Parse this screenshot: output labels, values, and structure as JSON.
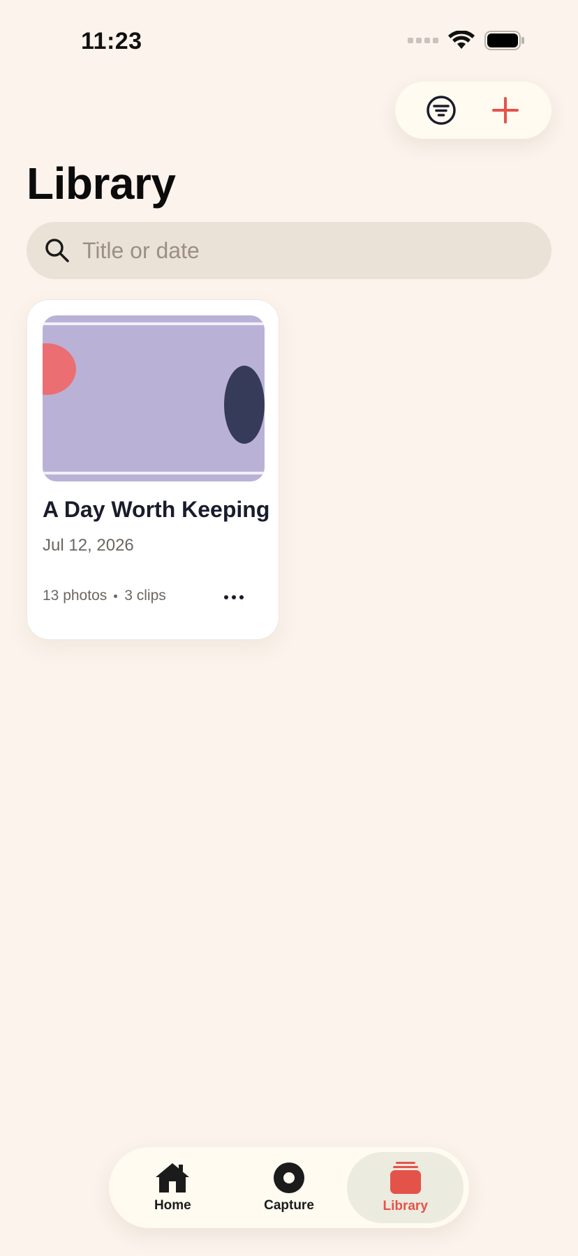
{
  "status_bar": {
    "time": "11:23"
  },
  "page": {
    "title": "Library"
  },
  "search": {
    "placeholder": "Title or date",
    "value": ""
  },
  "cards": [
    {
      "title": "A Day Worth Keeping",
      "date": "Jul 12, 2026",
      "photos": "13 photos",
      "clips": "3 clips"
    }
  ],
  "tabs": [
    {
      "label": "Home",
      "icon": "house-icon",
      "active": false
    },
    {
      "label": "Capture",
      "icon": "record-icon",
      "active": false
    },
    {
      "label": "Library",
      "icon": "stack-icon",
      "active": true
    }
  ],
  "colors": {
    "background": "#fbf3ec",
    "accent": "#e4534a",
    "thumb_bg": "#bab2d6",
    "thumb_circle": "#eb6f72",
    "thumb_oval": "#363b59"
  }
}
